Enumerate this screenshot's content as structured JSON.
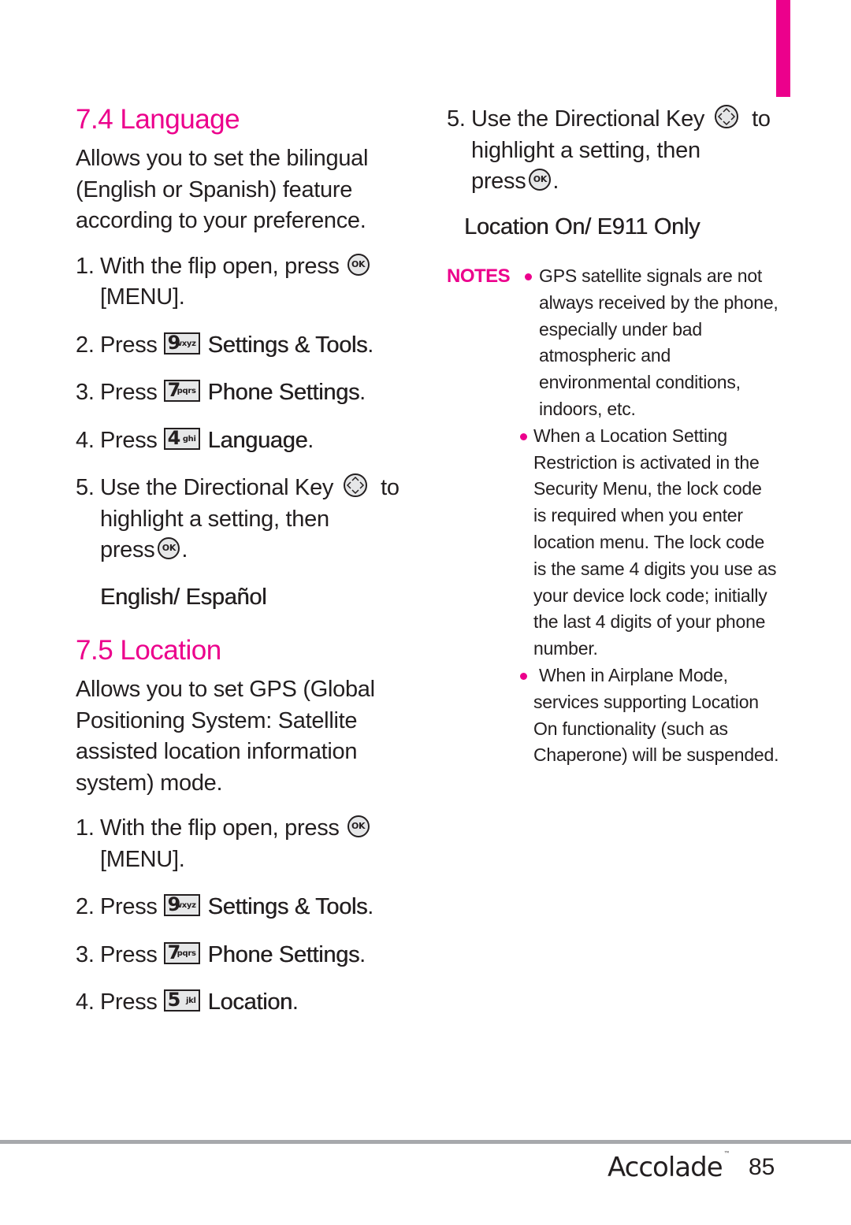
{
  "colors": {
    "accent": "#ec008c",
    "text": "#231f20",
    "rule": "#a7a9ac"
  },
  "language_section": {
    "title": "7.4 Language",
    "description_lines": [
      "Allows you to set the bilingual",
      "(English or Spanish) feature",
      "according to your preference."
    ],
    "steps": [
      {
        "num": "1.",
        "text": "With the flip open, press",
        "icon": "ok-key",
        "icon_label": "OK",
        "text_after": "[MENU]."
      },
      {
        "num": "2.",
        "text": "Press",
        "key_digit": "9",
        "key_letters": "wxyz",
        "target": "Settings & Tools",
        "suffix": "."
      },
      {
        "num": "3.",
        "text": "Press",
        "key_digit": "7",
        "key_letters": "pqrs",
        "target": "Phone Settings",
        "suffix": "."
      },
      {
        "num": "4.",
        "text": "Press",
        "key_digit": "4",
        "key_letters": "ghi",
        "target": "Language",
        "suffix": "."
      },
      {
        "num": "5.",
        "text": "Use the Directional Key",
        "icon": "directional-key",
        "text_after_icon": "to",
        "line2": "highlight a setting, then",
        "line3": "press",
        "icon2_label": "OK",
        "line3_suffix": "."
      }
    ],
    "option": "English/ Español"
  },
  "location_section": {
    "title": "7.5 Location",
    "description_lines": [
      "Allows you to set GPS (Global",
      "Positioning System: Satellite",
      "assisted location information",
      "system) mode."
    ],
    "steps": [
      {
        "num": "1.",
        "text": "With the flip open, press",
        "icon_label": "OK",
        "text_after": "[MENU]."
      },
      {
        "num": "2.",
        "text": "Press",
        "key_digit": "9",
        "key_letters": "wxyz",
        "target": "Settings & Tools",
        "suffix": "."
      },
      {
        "num": "3.",
        "text": "Press",
        "key_digit": "7",
        "key_letters": "pqrs",
        "target": "Phone Settings",
        "suffix": "."
      },
      {
        "num": "4.",
        "text": "Press",
        "key_digit": "5",
        "key_letters": "jkl",
        "target": "Location",
        "suffix": "."
      },
      {
        "num": "5.",
        "text": "Use the Directional Key",
        "text_after_icon": "to",
        "line2": "highlight a setting, then",
        "line3": "press",
        "icon2_label": "OK",
        "line3_suffix": "."
      }
    ],
    "option": "Location On/ E911 Only"
  },
  "notes": {
    "label": "NOTES",
    "items": [
      [
        "GPS satellite signals are not",
        "always received by the phone,",
        "especially under bad",
        "atmospheric and",
        "environmental conditions,",
        "indoors, etc."
      ],
      [
        "When a Location Setting",
        "Restriction is activated in the",
        "Security Menu, the lock code",
        "is required when you enter",
        "location menu. The lock code",
        "is the same 4 digits you use as",
        "your device lock code; initially",
        "the last 4 digits of your phone",
        "number."
      ],
      [
        "When in Airplane Mode,",
        "services supporting Location",
        "On functionality (such as",
        "Chaperone) will be suspended."
      ]
    ]
  },
  "footer": {
    "brand": "Accolade",
    "trademark": "™",
    "page_number": "85"
  }
}
